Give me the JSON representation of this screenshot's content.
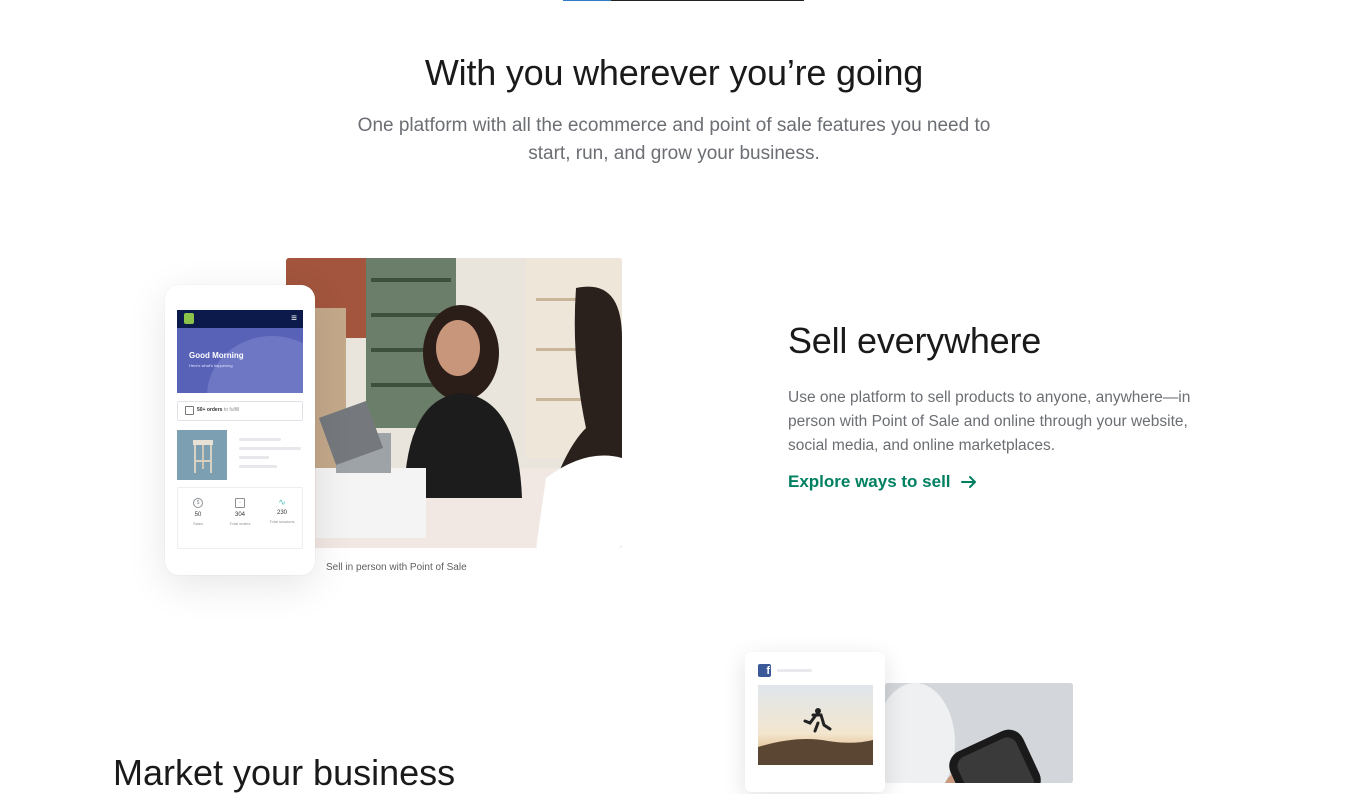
{
  "scroll_progress": {
    "value_fraction": 0.2,
    "colors": {
      "track": "#212326",
      "fill": "#2f7cc4"
    }
  },
  "intro": {
    "title": "With you wherever you’re going",
    "subtitle": "One platform with all the ecommerce and point of sale features you need to start, run, and grow your business."
  },
  "sell_everywhere": {
    "title": "Sell everywhere",
    "description": "Use one platform to sell products to anyone, anywhere—in person with Point of Sale and online through your website, social media, and online marketplaces.",
    "link_label": "Explore ways to sell",
    "link_icon": "arrow-right-icon",
    "link_color": "#008060",
    "image_caption": "Sell in person with Point of Sale",
    "phone_mockup": {
      "menu_icon": "≡",
      "greeting": "Good Morning",
      "greeting_sub": "Here's what's happening",
      "orders_bold": "50+ orders",
      "orders_rest": " to fulfill",
      "stats": [
        {
          "icon": "dollar-icon",
          "glyph": "$",
          "value": "50",
          "label": "Sales"
        },
        {
          "icon": "orders-icon",
          "glyph": "▫",
          "value": "304",
          "label": "Total orders"
        },
        {
          "icon": "sessions-chart-icon",
          "glyph": "∿",
          "value": "230",
          "label": "Total sessions"
        }
      ]
    }
  },
  "market_section": {
    "title_partial": "Market your business",
    "social_icon": "facebook-icon",
    "social_glyph": "f"
  }
}
